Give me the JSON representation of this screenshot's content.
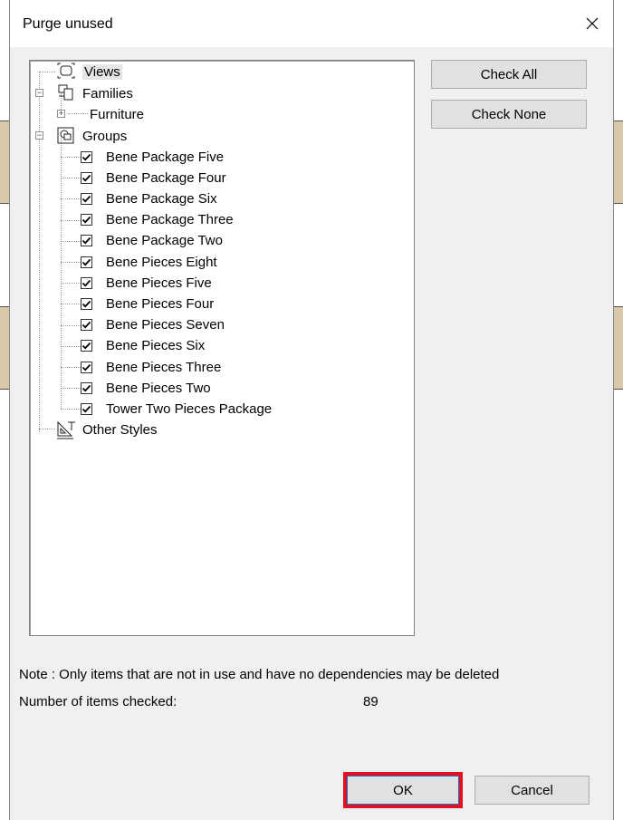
{
  "window": {
    "title": "Purge unused"
  },
  "buttons": {
    "check_all": "Check All",
    "check_none": "Check None",
    "ok": "OK",
    "cancel": "Cancel"
  },
  "tree": {
    "views": "Views",
    "families": "Families",
    "furniture": "Furniture",
    "groups": "Groups",
    "group_items": [
      "Bene Package Five",
      "Bene Package Four",
      "Bene Package Six",
      "Bene Package Three",
      "Bene Package Two",
      "Bene Pieces Eight",
      "Bene Pieces Five",
      "Bene Pieces Four",
      "Bene Pieces Seven",
      "Bene Pieces Six",
      "Bene Pieces Three",
      "Bene Pieces Two",
      "Tower Two Pieces Package"
    ],
    "other_styles": "Other Styles"
  },
  "footer": {
    "note": "Note : Only items that are not in use and have no dependencies may be deleted",
    "count_label": "Number of items checked:",
    "count_value": "89"
  },
  "colors": {
    "highlight": "#e4101e",
    "dialog_bg": "#f0f0f0"
  }
}
